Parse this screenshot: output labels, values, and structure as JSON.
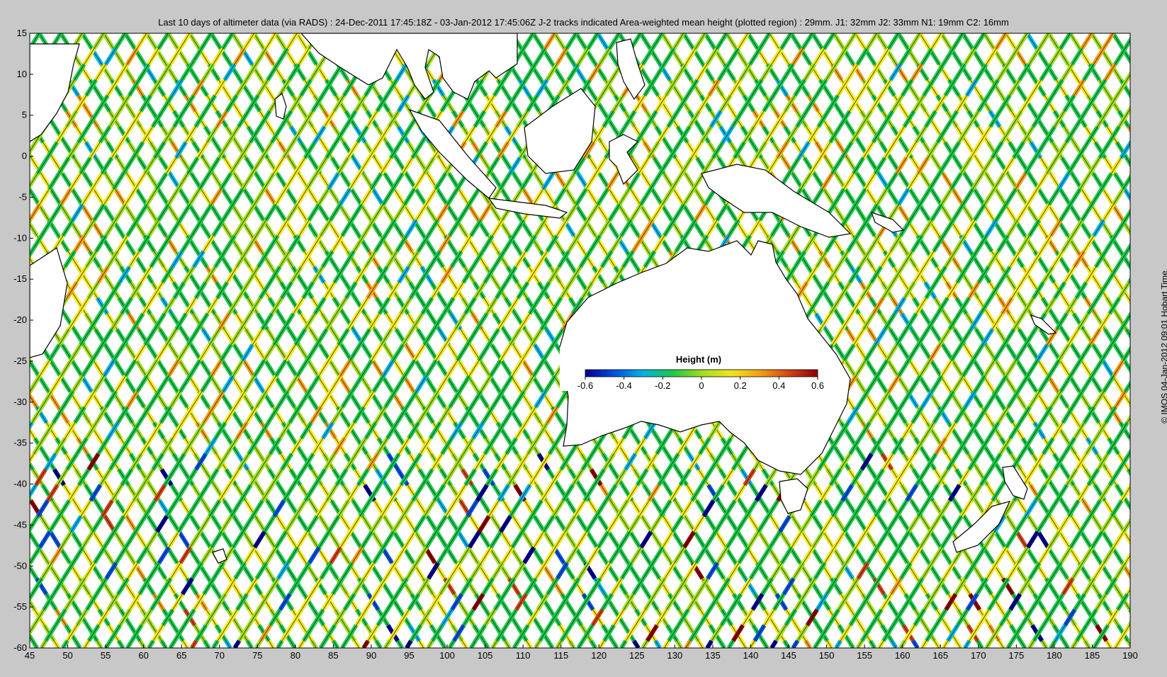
{
  "title": "Last 10 days of altimeter data (via RADS) : 24-Dec-2011 17:45:18Z - 03-Jan-2012 17:45:06Z  J-2 tracks indicated  Area-weighted mean height (plotted region) : 29mm.  J1: 32mm  J2: 33mm  N1: 19mm  C2: 16mm",
  "credit": "© IMOS 04-Jan-2012 09:01 Hobart Time",
  "colors": {
    "background": "#c8c8c8",
    "ocean_fill": "#ffffff",
    "land": "#ffffff",
    "coastline": "#000000",
    "colormap": [
      "#00008b",
      "#0050e0",
      "#00b4e6",
      "#1ec84a",
      "#9fdc1e",
      "#f0e61e",
      "#f5a014",
      "#d24614",
      "#8b0000"
    ]
  },
  "chart_data": {
    "type": "heatmap",
    "description_units": "degrees",
    "xlim": [
      45,
      190
    ],
    "ylim": [
      -60,
      15
    ],
    "x_ticks": [
      45,
      50,
      55,
      60,
      65,
      70,
      75,
      80,
      85,
      90,
      95,
      100,
      105,
      110,
      115,
      120,
      125,
      130,
      135,
      140,
      145,
      150,
      155,
      160,
      165,
      170,
      175,
      180,
      185,
      190
    ],
    "y_ticks": [
      15,
      10,
      5,
      0,
      -5,
      -10,
      -15,
      -20,
      -25,
      -30,
      -35,
      -40,
      -45,
      -50,
      -55,
      -60
    ],
    "colorbar": {
      "label": "Height (m)",
      "range": [
        -0.6,
        0.6
      ],
      "ticks": [
        "-0.6",
        "-0.4",
        "-0.2",
        "0",
        "0.2",
        "0.4",
        "0.6"
      ]
    },
    "track_spacing_deg": 2.83,
    "track_slope": 1.6
  }
}
